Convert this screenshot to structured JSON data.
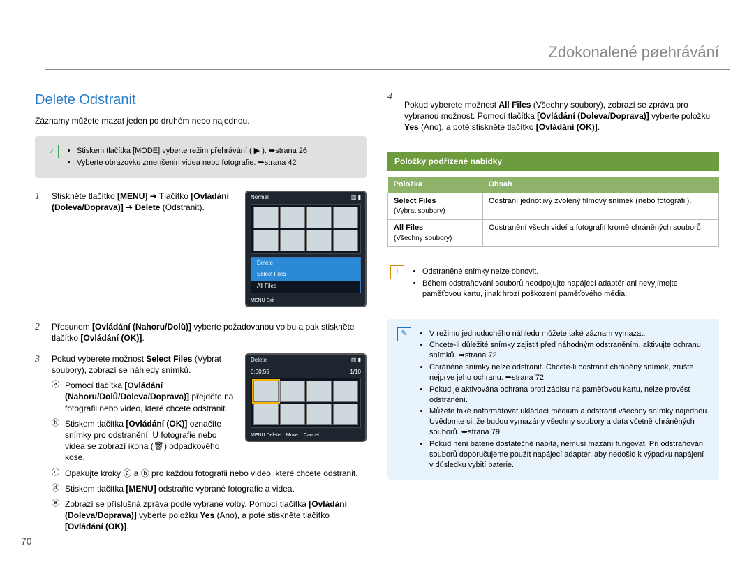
{
  "chapter_title": "Zdokonalené pøehrávání",
  "page_number": "70",
  "left": {
    "section_title": "Delete Odstranit",
    "intro": "Záznamy můžete mazat jeden po druhém nebo najednou.",
    "grey_tips": [
      "Stiskem tlačítka [MODE] vyberte režim přehrávání ( ▶ ). ➥strana 26",
      "Vyberte obrazovku zmenšenin videa nebo fotografie. ➥strana 42"
    ],
    "step1": {
      "num": "1",
      "line1_a": "Stiskněte tlačítko ",
      "line1_b": "[MENU]",
      "line1_c": " ➔ Tlačítko ",
      "line1_d": "[Ovládání (Doleva/Doprava)]",
      "line1_e": " ➔ ",
      "line1_f": "Delete",
      "line1_g": " (Odstranit)."
    },
    "screen1": {
      "top_left": "Normal",
      "menu_head": "Delete",
      "menu_hl": "Select Files",
      "menu_item": "All Files",
      "footer": "MENU Exit"
    },
    "step2": {
      "num": "2",
      "line_a": "Přesunem ",
      "line_b": "[Ovládání (Nahoru/Dolů)]",
      "line_c": " vyberte požadovanou volbu a pak stiskněte tlačítko ",
      "line_d": "[Ovládání (OK)]",
      "line_e": "."
    },
    "step3": {
      "num": "3",
      "line_a": "Pokud vyberete možnost ",
      "line_b": "Select Files",
      "line_c": " (Vybrat soubory), zobrazí se náhledy snímků."
    },
    "screen2": {
      "top_left": "Delete",
      "time": "0:00:55",
      "count": "1/10",
      "footer_a": "MENU Delete",
      "footer_b": "Move",
      "footer_c": "Cancel"
    },
    "sub": {
      "a_mark": "ⓐ",
      "a_text_a": "Pomocí tlačítka ",
      "a_text_b": "[Ovládání (Nahoru/Dolů/Doleva/Doprava)]",
      "a_text_c": " přejděte na fotografii nebo video, které chcete odstranit.",
      "b_mark": "ⓑ",
      "b_text_a": "Stiskem tlačítka ",
      "b_text_b": "[Ovládání (OK)]",
      "b_text_c": " označíte snímky pro odstranění. U fotografie nebo videa se zobrazí ikona (🗑) odpadkového koše.",
      "c_mark": "ⓒ",
      "c_text": "Opakujte kroky ⓐ a ⓑ pro každou fotografii nebo video, které chcete odstranit.",
      "d_mark": "ⓓ",
      "d_text_a": "Stiskem tlačítka ",
      "d_text_b": "[MENU]",
      "d_text_c": " odstraňte vybrané fotografie a videa.",
      "e_mark": "ⓔ",
      "e_text_a": "Zobrazí se příslušná zpráva podle vybrané volby. Pomocí tlačítka ",
      "e_text_b": "[Ovládání (Doleva/Doprava)]",
      "e_text_c": " vyberte položku ",
      "e_text_d": "Yes",
      "e_text_e": " (Ano), a poté stiskněte tlačítko ",
      "e_text_f": "[Ovládání (OK)]",
      "e_text_g": "."
    }
  },
  "right": {
    "step4": {
      "num": "4",
      "text_a": "Pokud vyberete možnost ",
      "text_b": "All Files",
      "text_c": " (Všechny soubory), zobrazí se zpráva pro vybranou možnost. Pomocí tlačítka ",
      "text_d": "[Ovládání (Doleva/Doprava)]",
      "text_e": " vyberte položku ",
      "text_f": "Yes",
      "text_g": " (Ano), a poté stiskněte tlačítko ",
      "text_h": "[Ovládání (OK)]",
      "text_i": "."
    },
    "sub_heading": "Položky podřízené nabídky",
    "table": {
      "head_item": "Položka",
      "head_content": "Obsah",
      "row1_name": "Select Files",
      "row1_sub": "(Vybrat soubory)",
      "row1_desc": "Odstraní jednotlivý zvolený filmový snímek (nebo fotografii).",
      "row2_name": "All Files",
      "row2_sub": "(Všechny soubory)",
      "row2_desc": "Odstranění všech videí a fotografií kromě chráněných souborů."
    },
    "warn": [
      "Odstraněné snímky nelze obnovit.",
      "Během odstraňování souborů neodpojujte napájecí adaptér ani nevyjímejte paměťovou kartu, jinak hrozí poškození paměťového média."
    ],
    "info": [
      "V režimu jednoduchého náhledu můžete také záznam vymazat.",
      "Chcete-li důležité snímky zajistit před náhodným odstraněním, aktivujte ochranu snímků. ➥strana 72",
      "Chráněné snímky nelze odstranit. Chcete-li odstranit chráněný snímek, zrušte nejprve jeho ochranu. ➥strana 72",
      "Pokud je aktivována ochrana proti zápisu na paměťovou kartu, nelze provést odstranění.",
      "Můžete také naformátovat ukládací médium a odstranit všechny snímky najednou. Uvědomte si, že budou vymazány všechny soubory a data včetně chráněných souborů. ➥strana 79",
      "Pokud není baterie dostatečně nabitá, nemusí mazání fungovat. Při odstraňování souborů doporučujeme použít napájecí adaptér, aby nedošlo k výpadku napájení v důsledku vybití baterie."
    ]
  }
}
